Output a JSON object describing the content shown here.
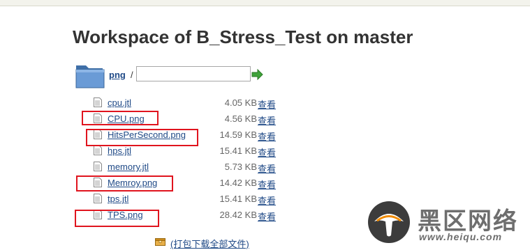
{
  "page": {
    "title": "Workspace of B_Stress_Test on master"
  },
  "path": {
    "folder_link": "png",
    "separator": "/",
    "input_value": ""
  },
  "files": [
    {
      "name": "cpu.jtl",
      "size": "4.05 KB",
      "view": "查看"
    },
    {
      "name": "CPU.png",
      "size": "4.56 KB",
      "view": "查看"
    },
    {
      "name": "HitsPerSecond.png",
      "size": "14.59 KB",
      "view": "查看"
    },
    {
      "name": "hps.jtl",
      "size": "15.41 KB",
      "view": "查看"
    },
    {
      "name": "memory.jtl",
      "size": "5.73 KB",
      "view": "查看"
    },
    {
      "name": "Memroy.png",
      "size": "14.42 KB",
      "view": "查看"
    },
    {
      "name": "tps.jtl",
      "size": "15.41 KB",
      "view": "查看"
    },
    {
      "name": "TPS.png",
      "size": "28.42 KB",
      "view": "查看"
    }
  ],
  "zip": {
    "label": "(打包下载全部文件)"
  },
  "watermark": {
    "chinese": "黑区网络",
    "url": "www.heiqu.com"
  },
  "colors": {
    "link": "#204a87",
    "highlight_box": "#e0141e",
    "folder": "#5b8fc9"
  },
  "icons": [
    "folder-icon",
    "go-arrow-icon",
    "file-icon",
    "zip-archive-icon",
    "mushroom-logo-icon"
  ]
}
